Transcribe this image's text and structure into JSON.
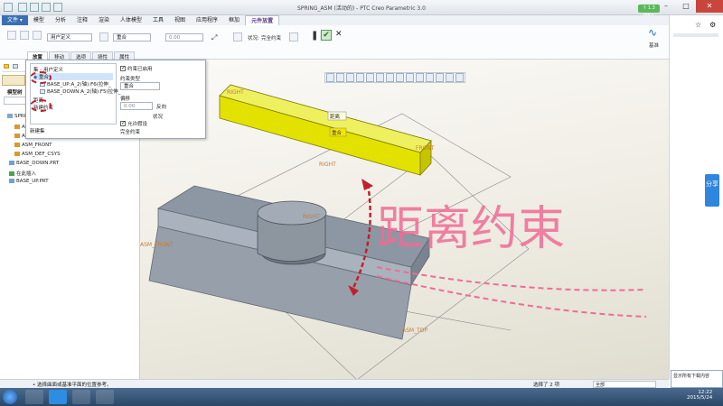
{
  "window": {
    "title": "SPRING_ASM (活动的) - PTC Creo Parametric 3.0",
    "speed": "↑ 1.3 MB/s"
  },
  "menu": {
    "items": [
      "文件 ▾",
      "模型",
      "分析",
      "注释",
      "渲染",
      "人体模型",
      "工具",
      "视图",
      "应用程序",
      "框加",
      "元件放置"
    ]
  },
  "ribbon": {
    "user_defined": "用户定义",
    "coincident": "重合",
    "offset_value": "0.00",
    "status_label": "状况:",
    "status_value": "完全约束",
    "base_label": "基准"
  },
  "subtabs": [
    "放置",
    "移动",
    "选项",
    "挠性",
    "属性"
  ],
  "popup": {
    "set_title": "集 - 用户定义",
    "constraint_1": "重合",
    "ref_1": "BASE_UP:A_2(轴):F6(拉伸_",
    "ref_2": "BASE_DOWN:A_2(轴):F5(拉伸_",
    "new_constraint": "新建约束",
    "distance_short": "距离",
    "new_set": "新建集",
    "enable": "约束已启用",
    "constraint_type_label": "约束类型",
    "constraint_type_value": "重合",
    "offset_label": "偏移",
    "offset_value": "0.00",
    "offset_dir": "反向",
    "allow_assume": "允许假设",
    "status_label": "状况",
    "status_value": "完全约束"
  },
  "tree": {
    "header": "模型树",
    "items": [
      "SPRING_ASM.ASM",
      "ASM_RIGHT",
      "ASM_TOP",
      "ASM_FRONT",
      "ASM_DEF_CSYS",
      "BASE_DOWN.PRT",
      "在此插入",
      "BASE_UP.PRT"
    ]
  },
  "viewport": {
    "label_right": "RIGHT",
    "label_front": "FRONT",
    "label_right2": "RIGHT",
    "label_front2": "ASM_FRONT",
    "label_top": "ASM_TOP",
    "label_distance": "距离",
    "label_coincident": "重合",
    "annotation": "距离约束"
  },
  "status": {
    "message": "• 选择曲面或基准平面的位置参考。",
    "selected": "选择了 2 项",
    "filter": "全部"
  },
  "rightstrip": {
    "share": "分享",
    "notify": "显示所有下载内容"
  },
  "clock": {
    "time": "12:22",
    "date": "2015/5/24"
  },
  "colors": {
    "accent": "#3a6fb5",
    "highlight_part": "#d8dc00",
    "base_part": "#8d97a3",
    "annotation": "#f06b96",
    "arrow": "#c0202d"
  }
}
